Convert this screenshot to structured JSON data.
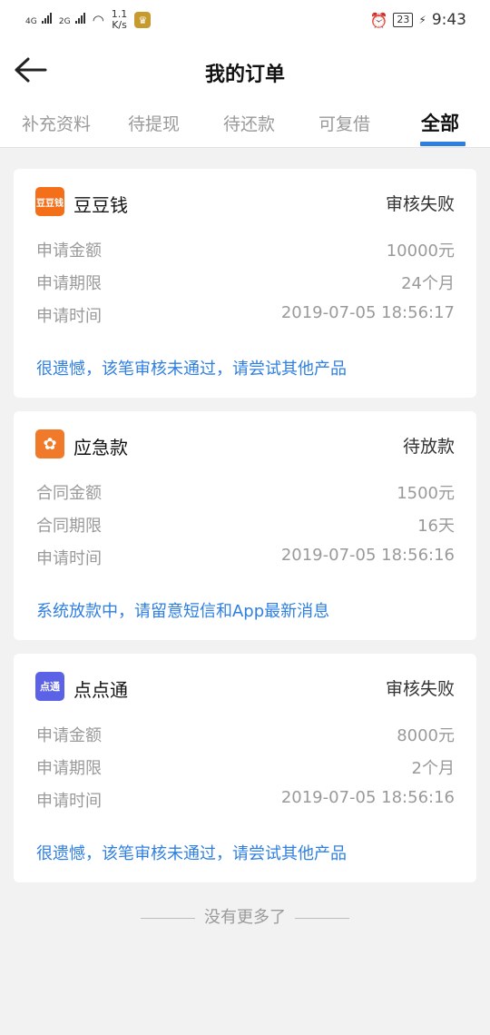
{
  "status_bar": {
    "signal1": "4G",
    "signal2": "2G",
    "speed_top": "1.1",
    "speed_bottom": "K/s",
    "battery": "23",
    "time": "9:43"
  },
  "header": {
    "title": "我的订单",
    "back_icon": "arrow-left-icon"
  },
  "tabs": [
    {
      "label": "补充资料",
      "active": false
    },
    {
      "label": "待提现",
      "active": false
    },
    {
      "label": "待还款",
      "active": false
    },
    {
      "label": "可复借",
      "active": false
    },
    {
      "label": "全部",
      "active": true
    }
  ],
  "orders": [
    {
      "name": "豆豆钱",
      "logo_text": "豆豆钱",
      "logo_color": "#f36f19",
      "status": "审核失败",
      "rows": [
        {
          "label": "申请金额",
          "value": "10000元"
        },
        {
          "label": "申请期限",
          "value": "24个月"
        },
        {
          "label": "申请时间",
          "value": "2019-07-05 18:56:17"
        }
      ],
      "notice": "很遗憾，该笔审核未通过，请尝试其他产品"
    },
    {
      "name": "应急款",
      "logo_text": "✿",
      "logo_color": "#f07a2a",
      "status": "待放款",
      "rows": [
        {
          "label": "合同金额",
          "value": "1500元"
        },
        {
          "label": "合同期限",
          "value": "16天"
        },
        {
          "label": "申请时间",
          "value": "2019-07-05 18:56:16"
        }
      ],
      "notice": "系统放款中，请留意短信和App最新消息"
    },
    {
      "name": "点点通",
      "logo_text": "点通",
      "logo_color": "#5b62e6",
      "status": "审核失败",
      "rows": [
        {
          "label": "申请金额",
          "value": "8000元"
        },
        {
          "label": "申请期限",
          "value": "2个月"
        },
        {
          "label": "申请时间",
          "value": "2019-07-05 18:56:16"
        }
      ],
      "notice": "很遗憾，该笔审核未通过，请尝试其他产品"
    }
  ],
  "footer": {
    "text": "没有更多了"
  },
  "colors": {
    "accent": "#2f7fe0",
    "background": "#f2f2f2"
  }
}
